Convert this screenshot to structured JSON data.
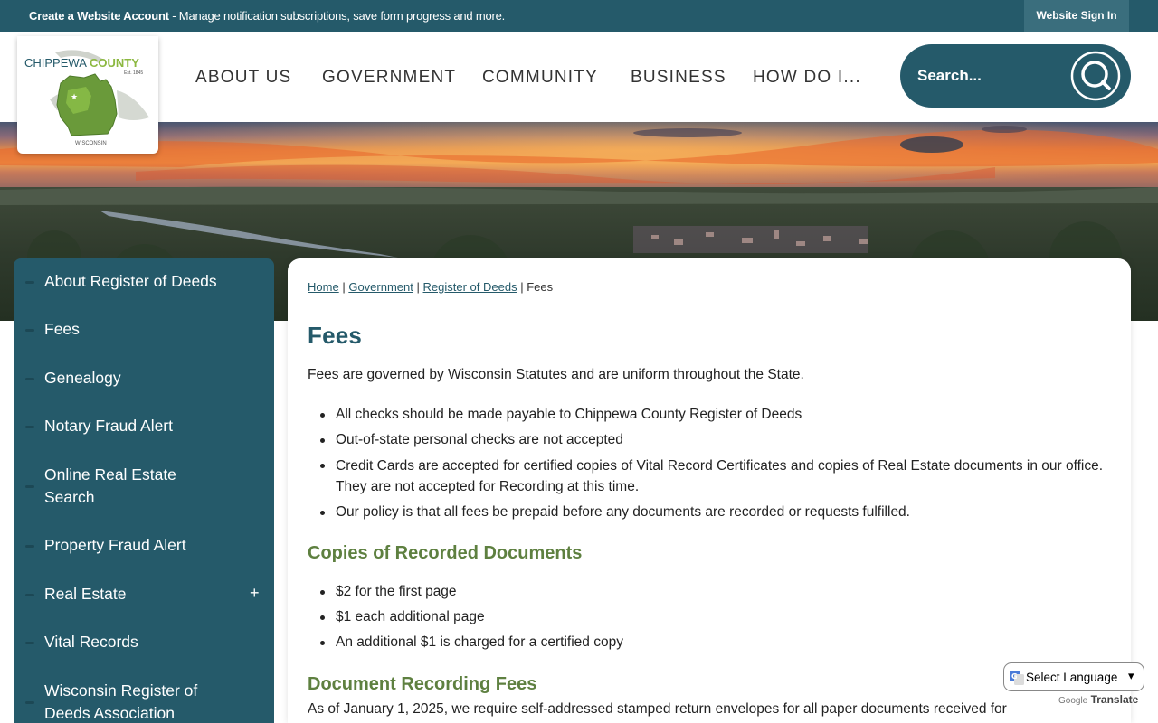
{
  "topbar": {
    "create_bold": "Create a Website Account",
    "create_rest": " - Manage notification subscriptions, save form progress and more.",
    "signin": "Website Sign In"
  },
  "logo": {
    "name_left": "CHIPPEWA",
    "name_right": "COUNTY",
    "established": "Est. 1845",
    "state": "WISCONSIN"
  },
  "nav": {
    "items": [
      "ABOUT US",
      "GOVERNMENT",
      "COMMUNITY",
      "BUSINESS",
      "HOW DO I..."
    ]
  },
  "search": {
    "placeholder": "Search..."
  },
  "sidebar": {
    "items": [
      {
        "label": "About Register of Deeds"
      },
      {
        "label": "Fees"
      },
      {
        "label": "Genealogy"
      },
      {
        "label": "Notary Fraud Alert"
      },
      {
        "label": "Online Real Estate Search"
      },
      {
        "label": "Property Fraud Alert"
      },
      {
        "label": "Real Estate",
        "expand": "+"
      },
      {
        "label": "Vital Records"
      },
      {
        "label": "Wisconsin Register of Deeds Association"
      }
    ]
  },
  "breadcrumb": {
    "home": "Home",
    "government": "Government",
    "register": "Register of Deeds",
    "current": "Fees",
    "separator": "|"
  },
  "content": {
    "title": "Fees",
    "intro": "Fees are governed by Wisconsin Statutes and are uniform throughout the State.",
    "bullets": [
      "All checks should be made payable to Chippewa County Register of Deeds",
      "Out-of-state personal checks are not accepted",
      "Credit Cards are accepted for certified copies of Vital Record Certificates and copies of Real Estate documents in our office. They are not accepted for Recording at this time.",
      "Our policy is that all fees be prepaid before any documents are recorded or requests fulfilled."
    ],
    "copies_heading": "Copies of Recorded Documents",
    "copies": [
      "$2 for the first page",
      "$1 each additional page",
      "An additional $1 is charged for a certified copy"
    ],
    "recording_heading": "Document Recording Fees",
    "recording_para": "As of January 1, 2025, we require self-addressed stamped return envelopes for all paper documents received for"
  },
  "translate": {
    "label": "Select Language",
    "arrow": "▾",
    "powered_google": "Google",
    "powered_translate": "Translate"
  },
  "colors": {
    "teal": "#255a6a",
    "green": "#5e8040",
    "sunset": "#e9752a"
  }
}
